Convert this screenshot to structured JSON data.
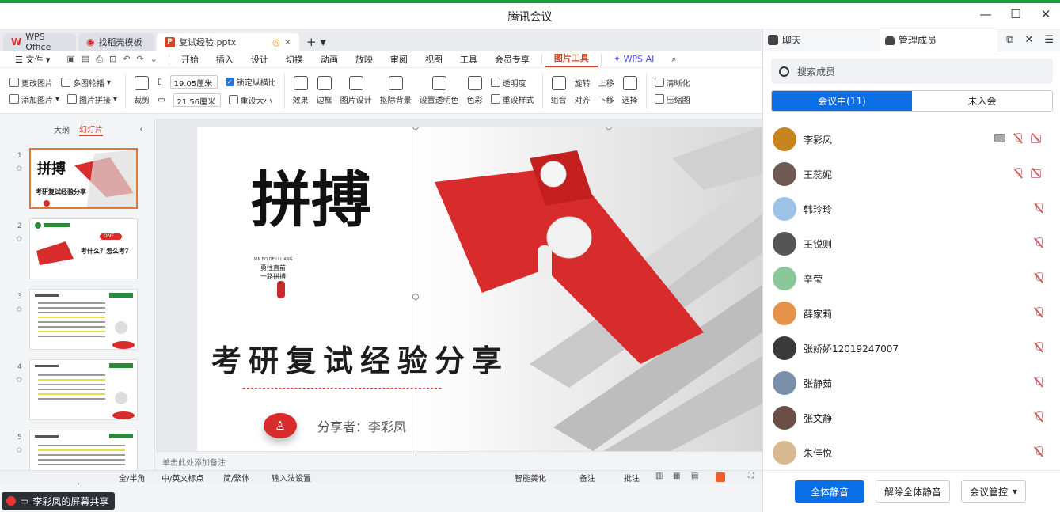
{
  "window": {
    "title": "腾讯会议"
  },
  "wps": {
    "tabs": [
      {
        "label": "WPS Office"
      },
      {
        "label": "找稻壳模板"
      },
      {
        "label": "复试经验.pptx"
      }
    ],
    "file_menu": "文件",
    "menu": [
      "开始",
      "插入",
      "设计",
      "切换",
      "动画",
      "放映",
      "审阅",
      "视图",
      "工具",
      "会员专享",
      "图片工具"
    ],
    "active_menu": "图片工具",
    "wps_ai": "WPS AI",
    "ribbon": {
      "change_image": "更改图片",
      "multi_carousel": "多图轮播",
      "add_image": "添加图片",
      "image_collage": "图片拼接",
      "crop": "裁剪",
      "width_value": "19.05厘米",
      "height_value": "21.56厘米",
      "lock_ratio": "锁定纵横比",
      "reset_size": "重设大小",
      "effects": "效果",
      "border": "边框",
      "image_design": "图片设计",
      "remove_bg": "抠除背景",
      "set_transparent": "设置透明色",
      "color": "色彩",
      "transparency": "透明度",
      "reset_style": "重设样式",
      "combine": "组合",
      "rotate": "旋转",
      "align": "对齐",
      "bring_up": "上移",
      "send_down": "下移",
      "select": "选择",
      "clarify": "清晰化",
      "compress": "压缩图"
    },
    "pane_tabs": {
      "outline": "大纲",
      "slides": "幻灯片"
    },
    "slide_numbers": [
      "1",
      "2",
      "3",
      "4",
      "5"
    ],
    "thumb2": {
      "badge": "ONE",
      "text": "考什么？怎么考？"
    },
    "notes_placeholder": "单击此处添加备注",
    "status": {
      "fullhalf": "全/半角",
      "punct": "中/英文标点",
      "simptrad": "简/繁体",
      "ime": "输入法设置",
      "beautify": "智能美化",
      "notes": "备注",
      "comments": "批注"
    },
    "share_badge": "李彩凤的屏幕共享"
  },
  "slide": {
    "calligraphy": "拼搏",
    "calli_pinyin": "PIN BO DE LI LIANG",
    "calli_sub1": "勇往直前",
    "calli_sub2": "一路拼搏",
    "title": "考研复试经验分享",
    "presenter": "分享者：李彩凤"
  },
  "panel": {
    "tab_chat": "聊天",
    "tab_manage": "管理成员",
    "search_placeholder": "搜索成员",
    "seg_in": "会议中(11)",
    "seg_out": "未入会",
    "members": [
      {
        "name": "李彩凤",
        "avatar_color": "#c8841e",
        "screen": true,
        "mic_off": true,
        "cam_off": true
      },
      {
        "name": "王蕊妮",
        "avatar_color": "#6e5a52",
        "screen": false,
        "mic_off": true,
        "cam_off": true
      },
      {
        "name": "韩玲玲",
        "avatar_color": "#9cc2e6",
        "screen": false,
        "mic_off": true,
        "cam_off": false
      },
      {
        "name": "王锐则",
        "avatar_color": "#555555",
        "screen": false,
        "mic_off": true,
        "cam_off": false
      },
      {
        "name": "辛莹",
        "avatar_color": "#8cc79a",
        "screen": false,
        "mic_off": true,
        "cam_off": false
      },
      {
        "name": "薛家莉",
        "avatar_color": "#e5924a",
        "screen": false,
        "mic_off": true,
        "cam_off": false
      },
      {
        "name": "张娇娇12019247007",
        "avatar_color": "#3a3a3a",
        "screen": false,
        "mic_off": true,
        "cam_off": false
      },
      {
        "name": "张静茹",
        "avatar_color": "#7a8fa8",
        "screen": false,
        "mic_off": true,
        "cam_off": false
      },
      {
        "name": "张文静",
        "avatar_color": "#6b4f46",
        "screen": false,
        "mic_off": true,
        "cam_off": false
      },
      {
        "name": "朱佳悦",
        "avatar_color": "#d8b990",
        "screen": false,
        "mic_off": true,
        "cam_off": false
      }
    ],
    "btn_mute_all": "全体静音",
    "btn_unmute_all": "解除全体静音",
    "btn_control": "会议管控"
  },
  "colors": {
    "accent_blue": "#0a6ee6",
    "wps_red": "#d24726",
    "slide_red": "#d82b2b"
  }
}
